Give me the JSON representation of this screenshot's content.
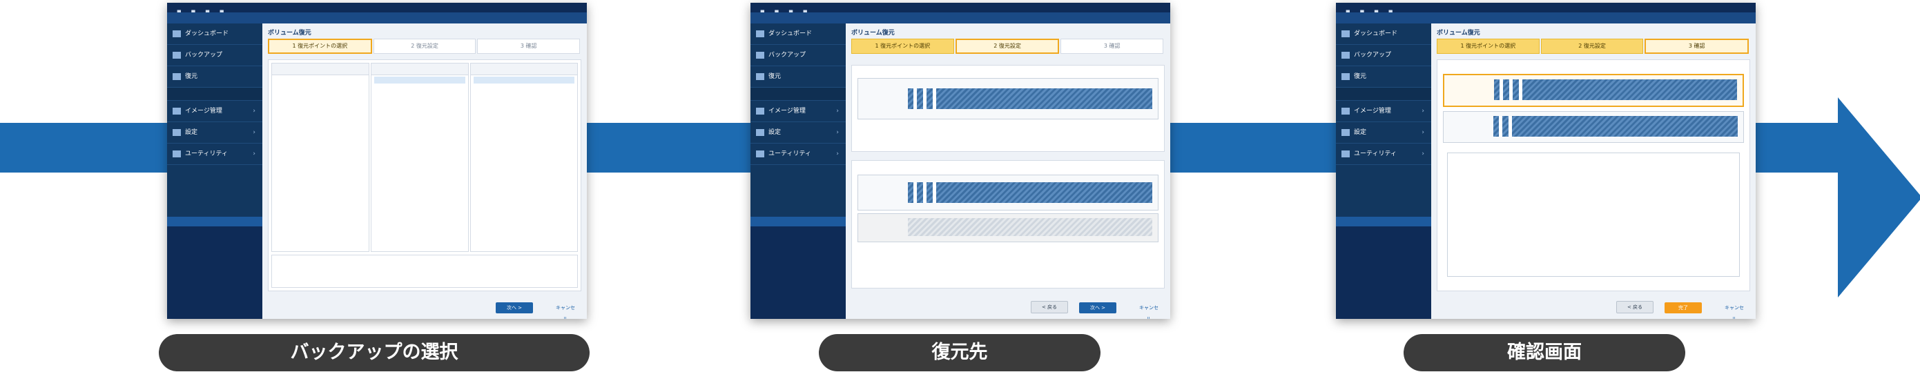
{
  "colors": {
    "arrow": "#1d6bb1",
    "caption_bg": "#3b3b3b",
    "sidebar": "#12375f",
    "step_active": "#f0a81e"
  },
  "captions": [
    "バックアップの選択",
    "復元先",
    "確認画面"
  ],
  "screens": [
    {
      "wizard_title": "ボリューム復元",
      "steps": [
        "1 復元ポイントの選択",
        "2 復元設定",
        "3 確認"
      ],
      "active_step": 1,
      "buttons": {
        "next": "次へ >",
        "cancel": "キャンセル"
      }
    },
    {
      "wizard_title": "ボリューム復元",
      "steps": [
        "1 復元ポイントの選択",
        "2 復元設定",
        "3 確認"
      ],
      "active_step": 2,
      "buttons": {
        "back": "< 戻る",
        "next": "次へ >",
        "cancel": "キャンセル"
      }
    },
    {
      "wizard_title": "ボリューム復元",
      "steps": [
        "1 復元ポイントの選択",
        "2 復元設定",
        "3 確認"
      ],
      "active_step": 3,
      "buttons": {
        "back": "< 戻る",
        "finish": "完了",
        "cancel": "キャンセル"
      }
    }
  ],
  "sidebar_items": [
    "ダッシュボード",
    "バックアップ",
    "復元",
    "イメージ管理",
    "設定",
    "ユーティリティ"
  ]
}
